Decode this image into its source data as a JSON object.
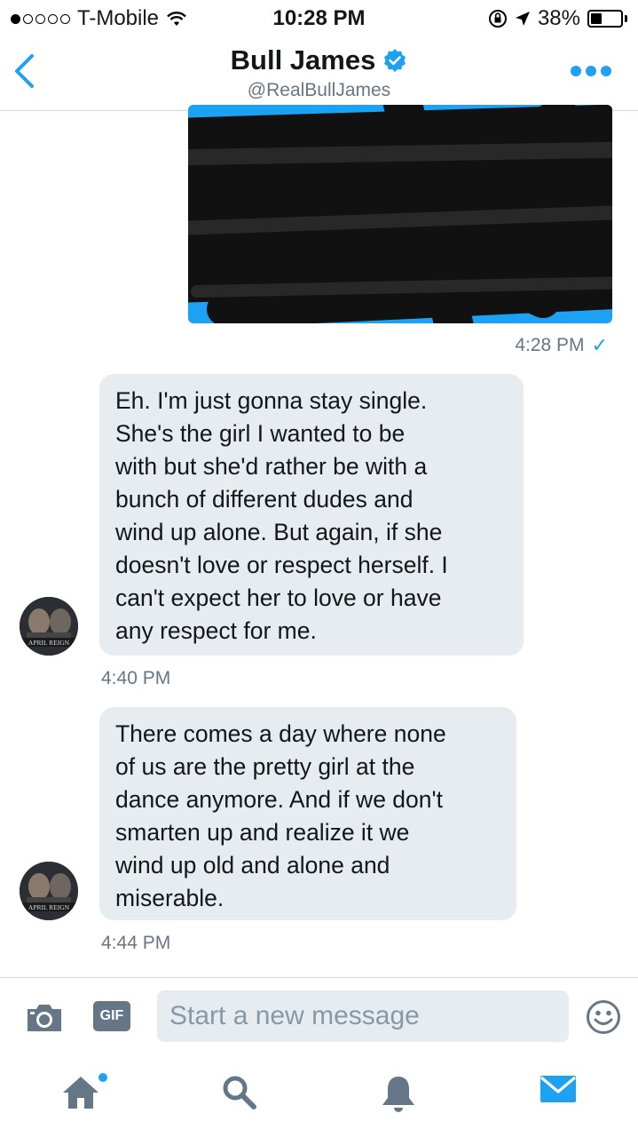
{
  "status_bar": {
    "carrier": "T-Mobile",
    "time": "10:28 PM",
    "battery": "38%",
    "battery_level": 0.38,
    "signal_bars": 1
  },
  "header": {
    "title": "Bull James",
    "handle": "@RealBullJames",
    "verified": true
  },
  "messages": {
    "outgoing": {
      "redacted": true,
      "time": "4:28 PM",
      "status_icon": "check-icon"
    },
    "incoming": [
      {
        "text": "Eh. I'm just gonna stay single.\nShe's the girl I wanted to be\nwith but she'd rather be with a\nbunch of different dudes and\nwind up alone. But again, if she\ndoesn't love or respect herself. I\ncan't expect her to love or have\nany respect for me.",
        "time": "4:40 PM"
      },
      {
        "text": "There comes a day where none\nof us are the pretty girl at the\ndance anymore. And if we don't\nsmarten up and realize it we\nwind up old and alone and\nmiserable.",
        "time": "4:44 PM"
      }
    ],
    "avatar_caption": "APRIL REIGN"
  },
  "composer": {
    "gif_label": "GIF",
    "placeholder": "Start a new message"
  },
  "tabs": [
    "home-icon",
    "search-icon",
    "notifications-icon",
    "messages-icon"
  ],
  "colors": {
    "accent": "#1da1f2",
    "bubble": "#e6ecf0",
    "muted": "#657786"
  }
}
